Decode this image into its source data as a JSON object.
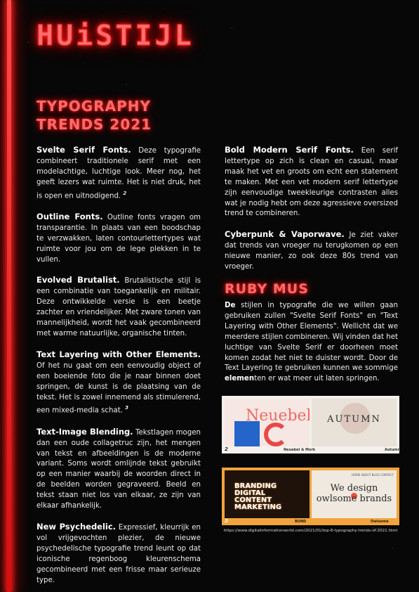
{
  "logo": "HUiSTIJL",
  "section_title_line1": "TYPOGRAPHY",
  "section_title_line2": "TRENDS 2021",
  "left_column": [
    {
      "heading": "Svelte Serif Fonts.",
      "text": " Deze typografie combineert traditionele serif met een modelachtige, luchtige look. Meer nog, het geeft lezers wat ruimte. Het is niet druk, het is open en uitnodigend. ",
      "footnote": "2"
    },
    {
      "heading": "Outline Fonts.",
      "text": " Outline fonts vragen om transparantie. In plaats van een boodschap te verzwakken, laten contourlettertypes wat ruimte voor jou om de lege plekken in te vullen.",
      "footnote": ""
    },
    {
      "heading": "Evolved Brutalist.",
      "text": " Brutalistische stijl is een combinatie van toegankelijk en militair. Deze ontwikkelde versie is een beetje zachter en vriendelijker. Met zware tonen van mannelijkheid, wordt het vaak gecombineerd met warme natuurlijke, organische tinten.",
      "footnote": ""
    },
    {
      "heading": "Text Layering with Other Elements.",
      "text": " Of het nu gaat om een eenvoudig object of een boeiende foto die je naar binnen doet springen, de kunst is de plaatsing van de tekst. Het is zowel innemend als stimulerend, een mixed-media schat. ",
      "footnote": "3"
    },
    {
      "heading": "Text-Image Blending.",
      "text": " Tekstlagen mogen dan een oude collagetruc zijn, het mengen van tekst en afbeeldingen is de moderne variant. Soms wordt omlijnde tekst gebruikt op een manier waarbij de woorden direct in de beelden worden gegraveerd. Beeld en tekst staan niet los van elkaar, ze zijn van elkaar afhankelijk.",
      "footnote": ""
    },
    {
      "heading": "New Psychedelic.",
      "text": " Expressief, kleurrijk en vol vrijgevochten plezier, de nieuwe psychedelische typografie trend leunt op dat iconische regenboog kleurenschema gecombineerd met een frisse maar serieuze type.",
      "footnote": ""
    }
  ],
  "right_column": [
    {
      "heading": "Bold Modern Serif Fonts.",
      "text": " Een serif lettertype op zich is clean en casual, maar maak het vet en groots om echt een statement te maken. Met een vet modern serif lettertype zijn eenvoudige tweekleurige contrasten alles wat je nodig hebt om deze agressieve oversized trend te combineren."
    },
    {
      "heading": "Cyberpunk & Vaporwave.",
      "text": " Je ziet vaker dat trends van vroeger nu terugkomen op een nieuwe manier, zo ook deze 80s trend van vroeger."
    }
  ],
  "ruby_title": "RUBY MUS",
  "ruby_text": {
    "part1_bold": "De",
    "part2": " stijlen in typografie die we willen gaan gebruiken zullen \"Svelte Serif Fonts\" en \"Text Layering with Other Elements\". Wellicht dat we meerdere stijlen combineren. Wij vinden dat het luchtige van Svelte Serif er doorheen moet komen zodat het niet te duister wordt. Door de Text Layering te gebruiken kunnen we sommige ",
    "part3_bold": "elemen",
    "part4": "ten er wat meer uit laten springen."
  },
  "figures": {
    "panel1": {
      "number": "2",
      "left_word": "Neuebel",
      "left_label": "Neuebel & Mork",
      "right_word": "AUTUMN",
      "right_label": "Autumn"
    },
    "panel2": {
      "number": "3",
      "left_word": "BRANDING DIGITAL CONTENT MARKETING",
      "left_label": "BUND",
      "right_word": "We design owlsome brands",
      "right_label": "Owlsome Studio",
      "right_nav": "HOME  ABOUT  BLOG  CONTACT"
    }
  },
  "caption": "https://www.digitalinformationworld.com/2021/01/top-8-typography-trends-of-2021.html",
  "colors": {
    "neon_red": "#ff2020",
    "background": "#070707",
    "panel2_orange": "#f2a33b"
  }
}
